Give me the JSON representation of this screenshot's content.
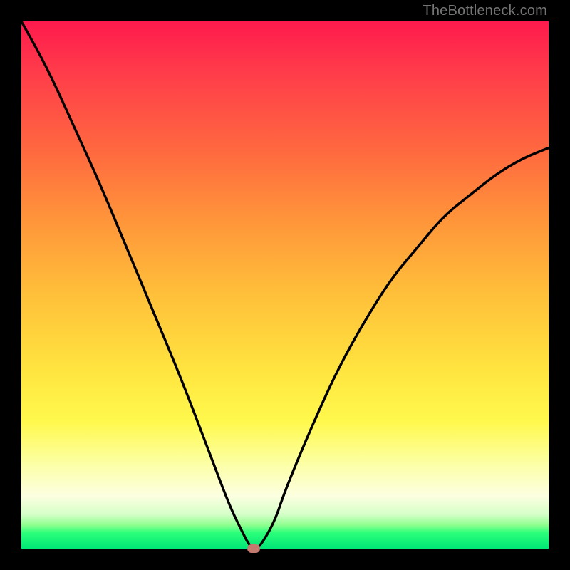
{
  "watermark": "TheBottleneck.com",
  "chart_data": {
    "type": "line",
    "title": "",
    "xlabel": "",
    "ylabel": "",
    "xlim": [
      0,
      100
    ],
    "ylim": [
      0,
      100
    ],
    "series": [
      {
        "name": "bottleneck-curve",
        "x": [
          0,
          5,
          10,
          15,
          20,
          25,
          30,
          35,
          38,
          40,
          42,
          43,
          44,
          45,
          48,
          50,
          55,
          60,
          65,
          70,
          75,
          80,
          85,
          90,
          95,
          100
        ],
        "values": [
          100,
          91,
          80,
          69,
          57,
          45,
          33,
          20,
          12,
          7,
          3,
          1,
          0,
          0,
          5,
          11,
          23,
          34,
          43,
          51,
          57,
          63,
          67,
          71,
          74,
          76
        ]
      }
    ],
    "marker": {
      "x": 44,
      "y": 0,
      "name": "optimal-point"
    },
    "gradient_stops": [
      {
        "pos": 0,
        "color": "#ff1a4d"
      },
      {
        "pos": 0.52,
        "color": "#ffc03a"
      },
      {
        "pos": 0.9,
        "color": "#fcffe0"
      },
      {
        "pos": 1.0,
        "color": "#00e676"
      }
    ]
  }
}
